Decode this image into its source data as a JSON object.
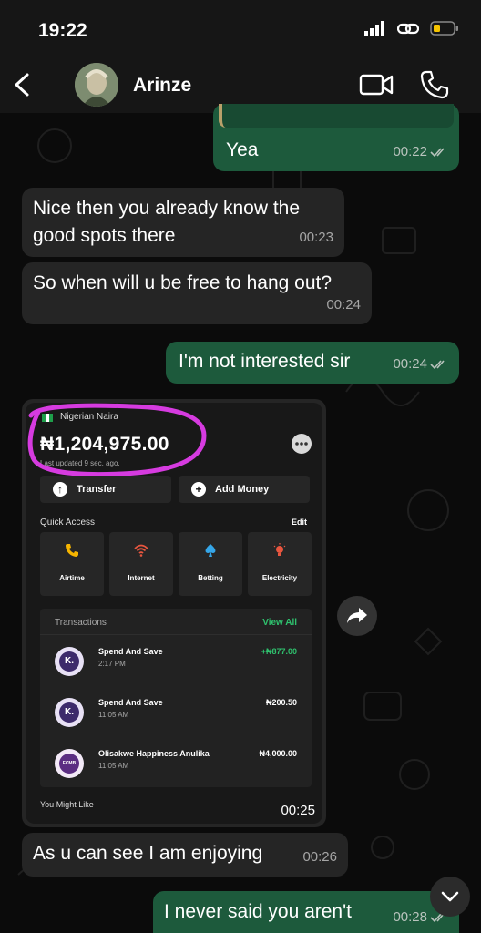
{
  "status_bar": {
    "time": "19:22"
  },
  "header": {
    "contact_name": "Arinze"
  },
  "messages": [
    {
      "direction": "out",
      "text": "Yea",
      "time": "00:22"
    },
    {
      "direction": "in",
      "text": "Nice then you already know the good spots there",
      "time": "00:23"
    },
    {
      "direction": "in",
      "text": "So when will u be free to hang out?",
      "time": "00:24"
    },
    {
      "direction": "out",
      "text": "I'm not interested sir",
      "time": "00:24"
    },
    {
      "direction": "in",
      "type": "image",
      "time": "00:25"
    },
    {
      "direction": "in",
      "text": "As u can see I am enjoying",
      "time": "00:26"
    },
    {
      "direction": "out",
      "text": "I never said you aren't",
      "time": "00:28"
    }
  ],
  "image_content": {
    "currency": "Nigerian Naira",
    "balance": "₦1,204,975.00",
    "last_updated": "Last updated 9 sec. ago.",
    "transfer_label": "Transfer",
    "add_money_label": "Add Money",
    "quick_access_label": "Quick Access",
    "edit_label": "Edit",
    "quick_access": [
      {
        "label": "Airtime",
        "icon": "phone-icon",
        "color": "#f5b400"
      },
      {
        "label": "Internet",
        "icon": "wifi-icon",
        "color": "#e8563f"
      },
      {
        "label": "Betting",
        "icon": "spade-icon",
        "color": "#35a6e8"
      },
      {
        "label": "Electricity",
        "icon": "bulb-icon",
        "color": "#e8563f"
      }
    ],
    "transactions_label": "Transactions",
    "view_all_label": "View All",
    "transactions": [
      {
        "name": "Spend And Save",
        "time": "2:17 PM",
        "amount": "+₦877.00",
        "logo": "K.",
        "amount_color": "#2fc26e"
      },
      {
        "name": "Spend And Save",
        "time": "11:05 AM",
        "amount": "₦200.50",
        "logo": "K.",
        "amount_color": "#ffffff"
      },
      {
        "name": "Olisakwe Happiness Anulika",
        "time": "11:05 AM",
        "amount": "₦4,000.00",
        "logo": "FCMB",
        "amount_color": "#ffffff"
      }
    ],
    "you_might_like": "You Might Like"
  },
  "colors": {
    "outgoing": "#1d5a3c",
    "incoming": "#252525",
    "highlight": "#d63be0"
  }
}
